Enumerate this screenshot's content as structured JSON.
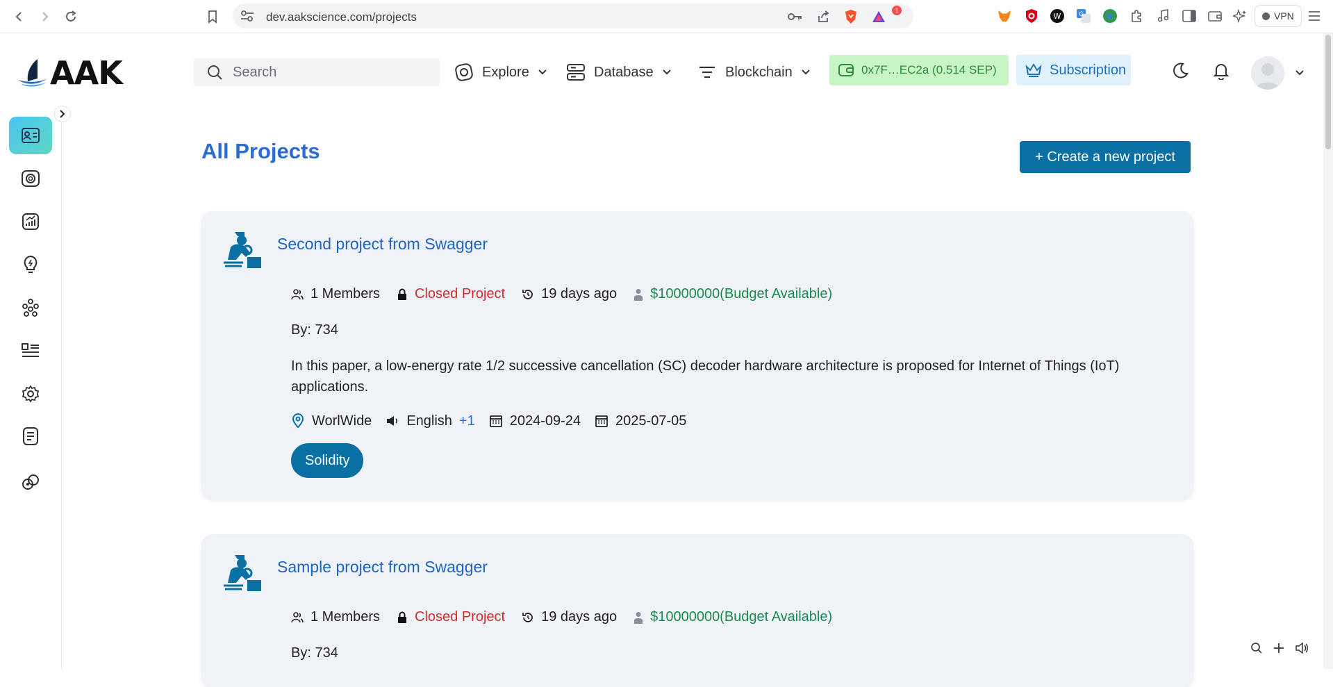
{
  "browser": {
    "url": "dev.aakscience.com/projects",
    "notification_count": "1",
    "vpn_label": "VPN"
  },
  "header": {
    "logo_text": "AAK",
    "search_placeholder": "Search",
    "menus": [
      {
        "label": "Explore",
        "icon": "explore-icon"
      },
      {
        "label": "Database",
        "icon": "database-icon"
      },
      {
        "label": "Blockchain",
        "icon": "blockchain-icon"
      }
    ],
    "wallet_label": "0x7F…EC2a (0.514 SEP)",
    "subscription_label": "Subscription"
  },
  "sidebar": {
    "items": [
      {
        "icon": "id-card-icon",
        "active": true
      },
      {
        "icon": "camera-icon",
        "active": false
      },
      {
        "icon": "chart-icon",
        "active": false
      },
      {
        "icon": "lightbulb-icon",
        "active": false
      },
      {
        "icon": "team-icon",
        "active": false
      },
      {
        "icon": "list-icon",
        "active": false
      },
      {
        "icon": "settings-icon",
        "active": false
      },
      {
        "icon": "document-icon",
        "active": false
      },
      {
        "icon": "link-icon",
        "active": false
      }
    ]
  },
  "main": {
    "title": "All Projects",
    "create_button": "+ Create a new project",
    "projects": [
      {
        "title": "Second project from Swagger",
        "members": "1 Members",
        "status": "Closed Project",
        "time": "19 days ago",
        "budget": "$10000000(Budget Available)",
        "by": "By: 734",
        "description": "In this paper, a low-energy rate 1/2 successive cancellation (SC) decoder hardware architecture is proposed for Internet of Things (IoT) applications.",
        "location": "WorlWide",
        "language": "English",
        "language_extra": "+1",
        "start_date": "2024-09-24",
        "end_date": "2025-07-05",
        "tag": "Solidity"
      },
      {
        "title": "Sample project from Swagger",
        "members": "1 Members",
        "status": "Closed Project",
        "time": "19 days ago",
        "budget": "$10000000(Budget Available)",
        "by": "By: 734"
      }
    ]
  }
}
